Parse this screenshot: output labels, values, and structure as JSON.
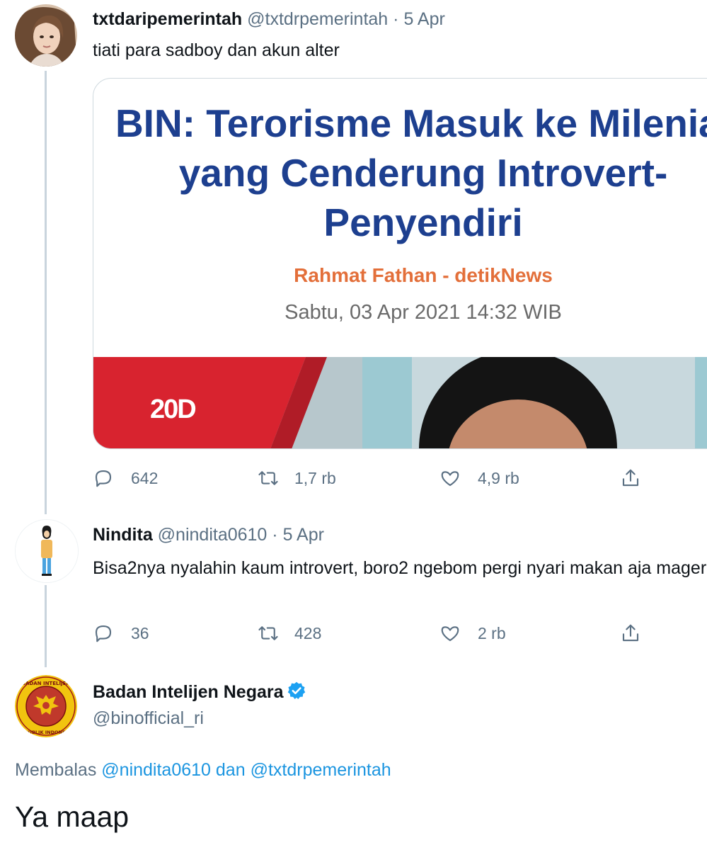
{
  "tweets": [
    {
      "name": "txtdaripemerintah",
      "handle": "@txtdrpemerintah",
      "separator": "·",
      "date": "5 Apr",
      "text": "tiati para sadboy dan akun alter",
      "card": {
        "headline": "BIN: Terorisme Masuk ke Milenial yang Cenderung Introvert-Penyendiri",
        "author": "Rahmat Fathan - detikNews",
        "date": "Sabtu, 03 Apr 2021 14:32 WIB",
        "logo": "20D"
      },
      "stats": {
        "replies": "642",
        "retweets": "1,7 rb",
        "likes": "4,9 rb"
      }
    },
    {
      "name": "Nindita",
      "handle": "@nindita0610",
      "separator": "·",
      "date": "5 Apr",
      "text": "Bisa2nya nyalahin kaum introvert, boro2 ngebom pergi nyari makan aja mager",
      "stats": {
        "replies": "36",
        "retweets": "428",
        "likes": "2 rb"
      }
    }
  ],
  "main_tweet": {
    "name": "Badan Intelijen Negara",
    "handle": "@binofficial_ri",
    "verified": true,
    "replying_prefix": "Membalas",
    "replying_to_1": "@nindita0610",
    "replying_joiner": "dan",
    "replying_to_2": "@txtdrpemerintah",
    "text": "Ya maap",
    "logo_ring_top": "BADAN INTELIJEN NEGARA",
    "logo_ring_bottom": "REPUBLIK INDONESIA"
  },
  "icons": {
    "reply": "reply-icon",
    "retweet": "retweet-icon",
    "like": "heart-icon",
    "share": "share-icon",
    "verified": "verified-badge-icon"
  },
  "colors": {
    "text": "#0f1419",
    "secondary": "#5b7083",
    "link": "#1b95e0",
    "thread_line": "#c9d4dd",
    "headline": "#1d3f8f",
    "author": "#e36f3a",
    "verified": "#1da1f2"
  }
}
